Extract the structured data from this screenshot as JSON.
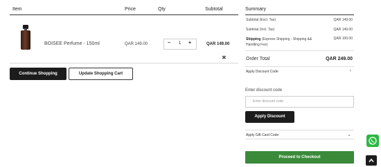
{
  "cart": {
    "headers": {
      "item": "Item",
      "price": "Price",
      "qty": "Qty",
      "subtotal": "Subtotal"
    },
    "items": [
      {
        "name": "BOISEE Perfume - 150ml",
        "price": "QAR 149.00",
        "qty": "1",
        "subtotal": "QAR 149.00"
      }
    ],
    "remove_icon": "close-icon",
    "continue_label": "Continue Shopping",
    "update_label": "Update Shopping Cart"
  },
  "summary": {
    "title": "Summary",
    "rows": [
      {
        "label": "Subtotal (Excl. Tax)",
        "value": "QAR 149.00"
      },
      {
        "label": "Subtotal (Incl. Tax)",
        "value": "QAR 149.00"
      }
    ],
    "shipping": {
      "label_bold": "Shipping",
      "label_rest": " (Express Shipping - Shipping && Handling Fee)",
      "value": "QAR 100.00"
    },
    "order_total": {
      "label": "Order Total",
      "value": "QAR 249.00"
    },
    "discount": {
      "toggle_label": "Apply Discount Code",
      "field_label": "Enter discount code",
      "placeholder": "Enter discount code",
      "apply_label": "Apply Discount"
    },
    "gift_card_label": "Apply Gift Card Code",
    "checkout_label": "Proceed to Checkout"
  },
  "floating": {
    "whatsapp_icon": "whatsapp-icon",
    "scroll_top_icon": "chevron-up-icon"
  },
  "colors": {
    "primary_dark": "#1c1c1c",
    "checkout_green": "#3a8a3a",
    "whatsapp_green": "#2db742"
  }
}
